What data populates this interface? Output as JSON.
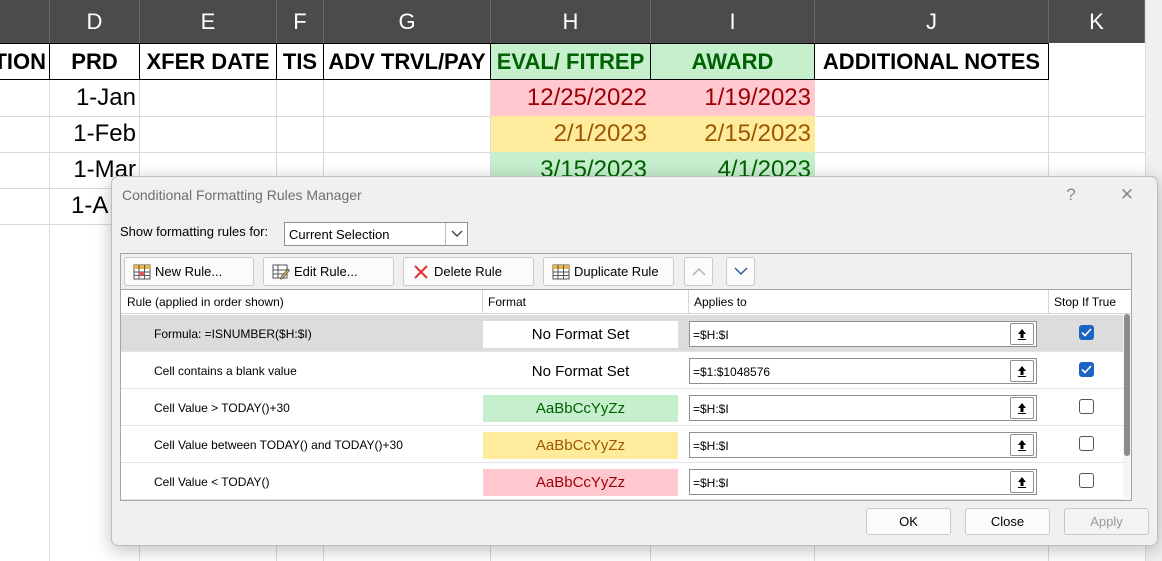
{
  "sheet": {
    "columns": [
      "D",
      "E",
      "F",
      "G",
      "H",
      "I",
      "J",
      "K"
    ],
    "headers": {
      "cut": "TION",
      "prd": "PRD",
      "xfer": "XFER DATE",
      "tis": "TIS",
      "adv": "ADV TRVL/PAY",
      "eval": "EVAL/ FITREP",
      "award": "AWARD",
      "notes": "ADDITIONAL NOTES"
    },
    "rows": [
      {
        "prd": "1-Jan",
        "eval": "12/25/2022",
        "award": "1/19/2023"
      },
      {
        "prd": "1-Feb",
        "eval": "2/1/2023",
        "award": "2/15/2023"
      },
      {
        "prd": "1-Mar",
        "eval": "3/15/2023",
        "award": "4/1/2023"
      },
      {
        "prd": "1-A"
      }
    ],
    "colors": {
      "red_fill": "#ffc7ce",
      "red_text": "#9c0006",
      "yellow_fill": "#ffeb9c",
      "yellow_text": "#9c5700",
      "green_fill": "#c6efce",
      "green_text": "#006100",
      "column_header_bg": "#4b4b4b"
    }
  },
  "dialog": {
    "title": "Conditional Formatting Rules Manager",
    "help": "?",
    "close": "✕",
    "show_label": "Show formatting rules for:",
    "show_value": "Current Selection",
    "toolbar": {
      "new_rule": "New Rule...",
      "edit_rule": "Edit Rule...",
      "delete_rule": "Delete Rule",
      "duplicate_rule": "Duplicate Rule"
    },
    "columns": {
      "rule": "Rule (applied in order shown)",
      "format": "Format",
      "applies": "Applies to",
      "stop": "Stop If True"
    },
    "rules": [
      {
        "rule": "Formula: =ISNUMBER($H:$I)",
        "format": "No Format Set",
        "applies": "=$H:$I",
        "stop": true,
        "selected": true
      },
      {
        "rule": "Cell contains a blank value",
        "format": "No Format Set",
        "applies": "=$1:$1048576",
        "stop": true
      },
      {
        "rule": "Cell Value > TODAY()+30",
        "format": "AaBbCcYyZz",
        "applies": "=$H:$I",
        "stop": false,
        "style": "green"
      },
      {
        "rule": "Cell Value between TODAY() and TODAY()+30",
        "format": "AaBbCcYyZz",
        "applies": "=$H:$I",
        "stop": false,
        "style": "yellow"
      },
      {
        "rule": "Cell Value < TODAY()",
        "format": "AaBbCcYyZz",
        "applies": "=$H:$I",
        "stop": false,
        "style": "red"
      }
    ],
    "buttons": {
      "ok": "OK",
      "close": "Close",
      "apply": "Apply"
    },
    "icons": [
      "new-rule-icon",
      "edit-rule-icon",
      "delete-icon",
      "duplicate-icon",
      "move-up-icon",
      "move-down-icon",
      "collapse-range-icon",
      "checkmark-icon"
    ]
  }
}
